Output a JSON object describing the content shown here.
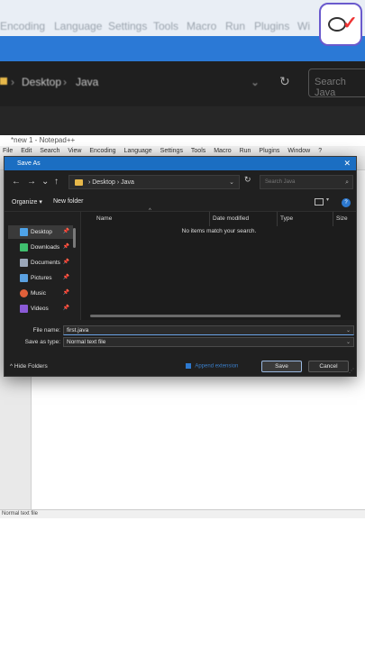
{
  "background_app": {
    "menu": [
      "Encoding",
      "Language",
      "Settings",
      "Tools",
      "Macro",
      "Run",
      "Plugins",
      "Wi"
    ],
    "breadcrumb": [
      "Desktop",
      "Java"
    ],
    "search_placeholder": "Search Java"
  },
  "notepad": {
    "title": "*new 1 - Notepad++",
    "menu": [
      "File",
      "Edit",
      "Search",
      "View",
      "Encoding",
      "Language",
      "Settings",
      "Tools",
      "Macro",
      "Run",
      "Plugins",
      "Window",
      "?"
    ],
    "status_text": "Normal text file"
  },
  "dialog": {
    "title": "Save As",
    "breadcrumb_1": "Desktop",
    "breadcrumb_2": "Java",
    "search_placeholder": "Search Java",
    "organize_label": "Organize",
    "new_folder_label": "New folder",
    "sidebar": [
      {
        "label": "Desktop",
        "color": "#4ea3e8"
      },
      {
        "label": "Downloads",
        "color": "#3fbf6e"
      },
      {
        "label": "Documents",
        "color": "#9aa6b8"
      },
      {
        "label": "Pictures",
        "color": "#5aa0e0"
      },
      {
        "label": "Music",
        "color": "#e0603a"
      },
      {
        "label": "Videos",
        "color": "#8a5ad6"
      }
    ],
    "columns": [
      "Name",
      "Date modified",
      "Type",
      "Size"
    ],
    "empty_message": "No items match your search.",
    "file_name_label": "File name:",
    "file_name_value": "first.java",
    "save_type_label": "Save as type:",
    "save_type_value": "Normal text file",
    "hide_folders_label": "Hide Folders",
    "append_label": "Append extension",
    "save_label": "Save",
    "cancel_label": "Cancel"
  }
}
